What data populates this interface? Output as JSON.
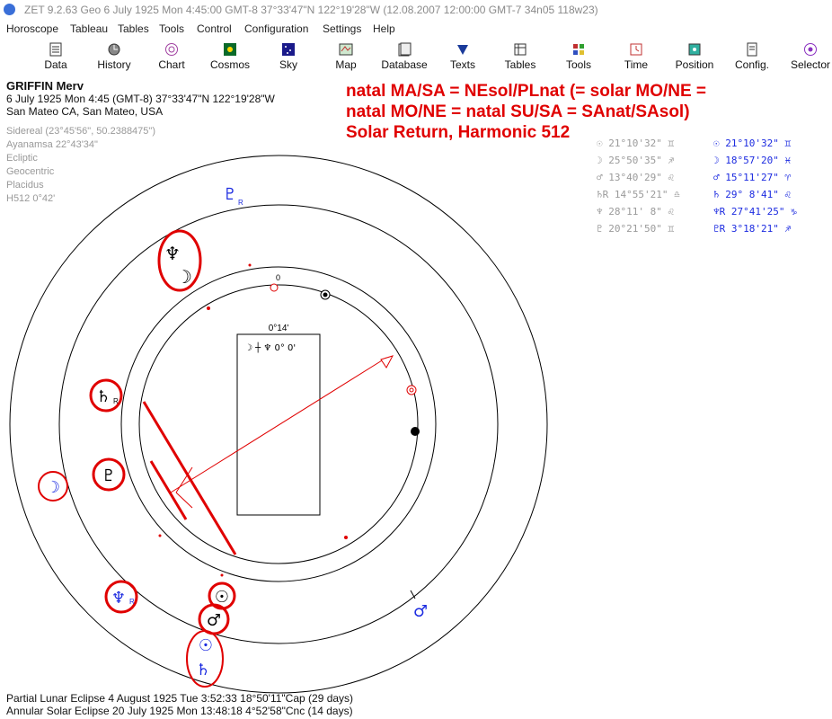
{
  "window": {
    "title": "ZET 9.2.63 Geo    6 July 1925  Mon   4:45:00 GMT-8 37°33'47\"N  122°19'28\"W   (12.08.2007  12:00:00 GMT-7 34n05 118w23)"
  },
  "menu": {
    "items": [
      "Horoscope",
      "Tableau",
      "Tables",
      "Tools",
      "Control",
      "Configuration",
      "Settings",
      "Help"
    ]
  },
  "toolbar": {
    "buttons": [
      {
        "label": "Data",
        "icon": "data-icon"
      },
      {
        "label": "History",
        "icon": "history-icon"
      },
      {
        "label": "Chart",
        "icon": "chart-icon"
      },
      {
        "label": "Cosmos",
        "icon": "cosmos-icon"
      },
      {
        "label": "Sky",
        "icon": "sky-icon"
      },
      {
        "label": "Map",
        "icon": "map-icon"
      },
      {
        "label": "Database",
        "icon": "database-icon"
      },
      {
        "label": "Texts",
        "icon": "texts-icon"
      },
      {
        "label": "Tables",
        "icon": "tables-icon"
      },
      {
        "label": "Tools",
        "icon": "tools-icon"
      },
      {
        "label": "Time",
        "icon": "time-icon"
      },
      {
        "label": "Position",
        "icon": "position-icon"
      },
      {
        "label": "Config.",
        "icon": "config-icon"
      },
      {
        "label": "Selector",
        "icon": "selector-icon"
      }
    ]
  },
  "person": {
    "name": "GRIFFIN Merv",
    "datetime": "6 July 1925  Mon    4:45 (GMT-8) 37°33'47\"N  122°19'28\"W",
    "place": "San Mateo CA, San Mateo, USA"
  },
  "settings": {
    "sidereal": "Sidereal (23°45'56\", 50.2388475\")",
    "ayanamsa": "Ayanamsa 22°43'34\"",
    "ecliptic": "Ecliptic",
    "geocentric": "Geocentric",
    "placidus": "Placidus",
    "harmonic": "H512   0°42'"
  },
  "annotation": {
    "line1": "natal MA/SA = NEsol/PLnat (= solar MO/NE =",
    "line2": "natal MO/NE = natal SU/SA = SAnat/SAsol)",
    "line3": "Solar Return, Harmonic 512"
  },
  "positions": {
    "natal": [
      {
        "glyph": "☉",
        "deg": "21°10'32\"",
        "sign": "♊"
      },
      {
        "glyph": "☽",
        "deg": "25°50'35\"",
        "sign": "♐"
      },
      {
        "glyph": "♂",
        "deg": "13°40'29\"",
        "sign": "♌"
      },
      {
        "glyph": "♄R",
        "deg": "14°55'21\"",
        "sign": "♎"
      },
      {
        "glyph": "♆",
        "deg": "28°11' 8\"",
        "sign": "♌"
      },
      {
        "glyph": "♇",
        "deg": "20°21'50\"",
        "sign": "♊"
      }
    ],
    "solar": [
      {
        "glyph": "☉",
        "deg": "21°10'32\"",
        "sign": "♊"
      },
      {
        "glyph": "☽",
        "deg": "18°57'20\"",
        "sign": "♓"
      },
      {
        "glyph": "♂",
        "deg": "15°11'27\"",
        "sign": "♈"
      },
      {
        "glyph": "♄",
        "deg": "29° 8'41\"",
        "sign": "♌"
      },
      {
        "glyph": "♆R",
        "deg": "27°41'25\"",
        "sign": "♑"
      },
      {
        "glyph": "♇R",
        "deg": " 3°18'21\"",
        "sign": "♐"
      }
    ]
  },
  "wheel": {
    "center_marker": "0°14'",
    "midpoint_label": "☽ ┼ ♆   0° 0'",
    "zero_label": "0",
    "retro_mark": "R"
  },
  "eclipses": {
    "lunar": "Partial Lunar Eclipse 4 August 1925 Tue  3:52:33 18°50'11\"Cap (29 days)",
    "solar": "Annular Solar Eclipse 20 July 1925 Mon 13:48:18  4°52'58\"Cnc (14 days)"
  },
  "colors": {
    "accent_red": "#e00000",
    "blue": "#1c2be0",
    "gray": "#999999"
  }
}
